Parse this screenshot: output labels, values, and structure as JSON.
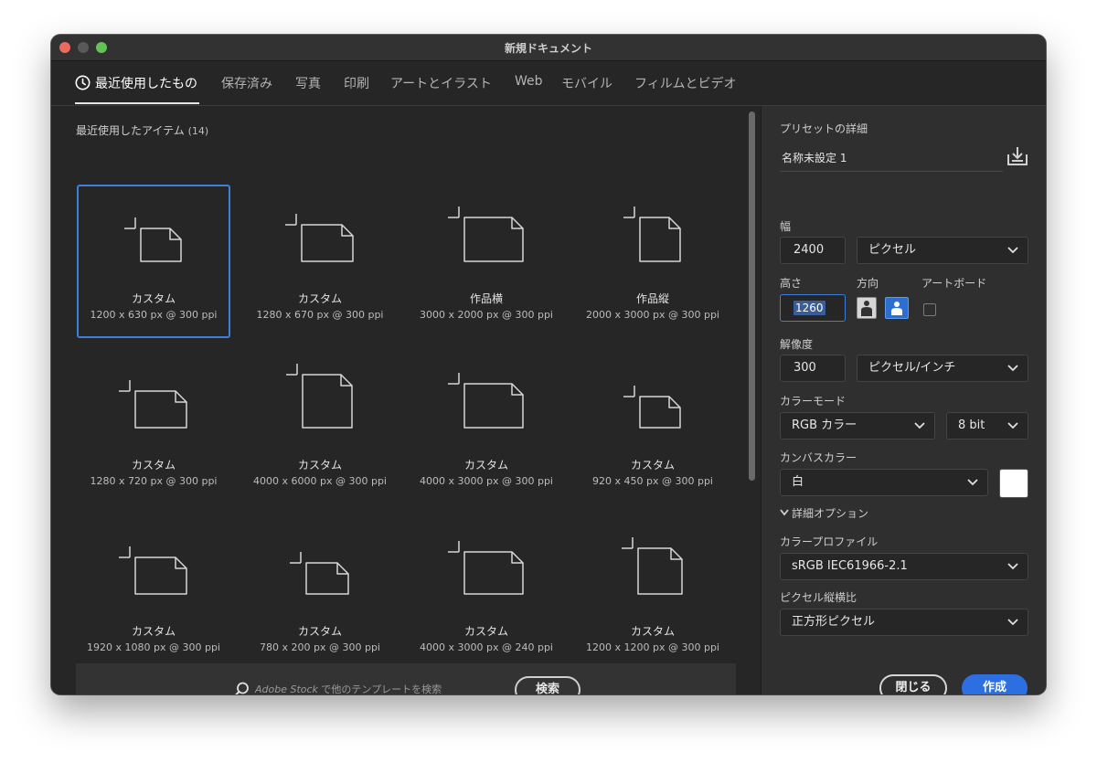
{
  "window": {
    "title": "新規ドキュメント"
  },
  "tabs": [
    {
      "label": "最近使用したもの"
    },
    {
      "label": "保存済み"
    },
    {
      "label": "写真"
    },
    {
      "label": "印刷"
    },
    {
      "label": "アートとイラスト"
    },
    {
      "label": "Web"
    },
    {
      "label": "モバイル"
    },
    {
      "label": "フィルムとビデオ"
    }
  ],
  "recent": {
    "title": "最近使用したアイテム",
    "count": "(14)",
    "items": [
      {
        "name": "カスタム",
        "detail": "1200 x 630 px @ 300 ppi"
      },
      {
        "name": "カスタム",
        "detail": "1280 x 670 px @ 300 ppi"
      },
      {
        "name": "作品横",
        "detail": "3000 x 2000 px @ 300 ppi"
      },
      {
        "name": "作品縦",
        "detail": "2000 x 3000 px @ 300 ppi"
      },
      {
        "name": "カスタム",
        "detail": "1280 x 720 px @ 300 ppi"
      },
      {
        "name": "カスタム",
        "detail": "4000 x 6000 px @ 300 ppi"
      },
      {
        "name": "カスタム",
        "detail": "4000 x 3000 px @ 300 ppi"
      },
      {
        "name": "カスタム",
        "detail": "920 x 450 px @ 300 ppi"
      },
      {
        "name": "カスタム",
        "detail": "1920 x 1080 px @ 300 ppi"
      },
      {
        "name": "カスタム",
        "detail": "780 x 200 px @ 300 ppi"
      },
      {
        "name": "カスタム",
        "detail": "4000 x 3000 px @ 240 ppi"
      },
      {
        "name": "カスタム",
        "detail": "1200 x 1200 px @ 300 ppi"
      }
    ]
  },
  "search": {
    "brand": "Adobe Stock",
    "placeholder_rest": " で他のテンプレートを検索",
    "button_label": "検索"
  },
  "preset": {
    "heading": "プリセットの詳細",
    "name": "名称未設定 1",
    "width_label": "幅",
    "width_value": "2400",
    "width_unit": "ピクセル",
    "height_label": "高さ",
    "height_value": "1260",
    "orientation_label": "方向",
    "artboard_label": "アートボード",
    "resolution_label": "解像度",
    "resolution_value": "300",
    "resolution_unit": "ピクセル/インチ",
    "color_mode_label": "カラーモード",
    "color_mode_value": "RGB カラー",
    "bit_depth_value": "8 bit",
    "canvas_color_label": "カンバスカラー",
    "canvas_color_value": "白",
    "canvas_swatch_color": "#ffffff",
    "advanced_label": "詳細オプション",
    "color_profile_label": "カラープロファイル",
    "color_profile_value": "sRGB IEC61966-2.1",
    "pixel_aspect_label": "ピクセル縦横比",
    "pixel_aspect_value": "正方形ピクセル",
    "close_label": "閉じる",
    "create_label": "作成"
  },
  "colors": {
    "accent": "#2d6fe0",
    "selection_border": "#3f7fd8",
    "background": "#262626",
    "panel": "#2f2f2f"
  }
}
